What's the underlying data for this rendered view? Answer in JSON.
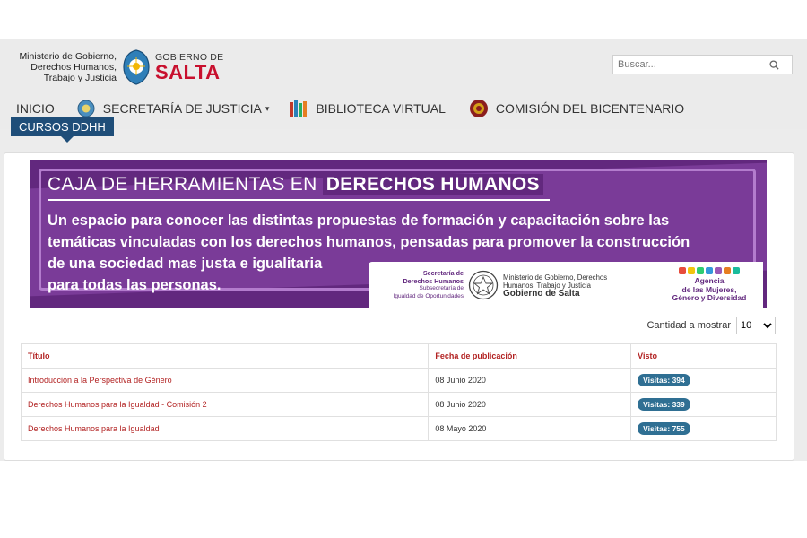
{
  "header": {
    "ministry_line1": "Ministerio de Gobierno,",
    "ministry_line2": "Derechos Humanos,",
    "ministry_line3": "Trabajo y Justicia",
    "gov_small": "GOBIERNO DE",
    "gov_big": "SALTA"
  },
  "search": {
    "placeholder": "Buscar..."
  },
  "nav": {
    "inicio": "INICIO",
    "secretaria": "SECRETARÍA DE JUSTICIA",
    "biblioteca": "BIBLIOTECA VIRTUAL",
    "comision": "COMISIÓN DEL BICENTENARIO",
    "cursos": "CURSOS DDHH"
  },
  "banner": {
    "title_prefix": "CAJA DE HERRAMIENTAS EN",
    "title_highlight": "DERECHOS HUMANOS",
    "line1": "Un espacio para conocer las distintas propuestas de formación y capacitación sobre las",
    "line2": "temáticas vinculadas con los derechos humanos, pensadas para promover la construcción",
    "line3": "de una sociedad mas justa e igualitaria",
    "line4": "para todas las personas.",
    "logo1_a": "Secretaría de",
    "logo1_b": "Derechos Humanos",
    "logo1_c": "Subsecretaría de",
    "logo1_d": "Igualdad de Oportunidades",
    "logo2_a": "Ministerio de Gobierno, Derechos",
    "logo2_b": "Humanos, Trabajo y Justicia",
    "logo2_c": "Gobierno de Salta",
    "logo3_a": "Agencia",
    "logo3_b": "de las Mujeres,",
    "logo3_c": "Género y Diversidad"
  },
  "list_controls": {
    "count_label": "Cantidad a mostrar",
    "count_value": "10"
  },
  "table": {
    "headers": [
      "Título",
      "Fecha de publicación",
      "Visto"
    ],
    "rows": [
      {
        "title": "Introducción a la Perspectiva de Género",
        "date": "08 Junio 2020",
        "views": "Visitas: 394"
      },
      {
        "title": "Derechos Humanos para la Igualdad - Comisión 2",
        "date": "08 Junio 2020",
        "views": "Visitas: 339"
      },
      {
        "title": "Derechos Humanos para la Igualdad",
        "date": "08 Mayo 2020",
        "views": "Visitas: 755"
      }
    ]
  },
  "colors": {
    "accent_purple": "#62287e",
    "nav_active": "#1f4e79",
    "link_red": "#b22222",
    "badge_blue": "#2f6f93"
  }
}
